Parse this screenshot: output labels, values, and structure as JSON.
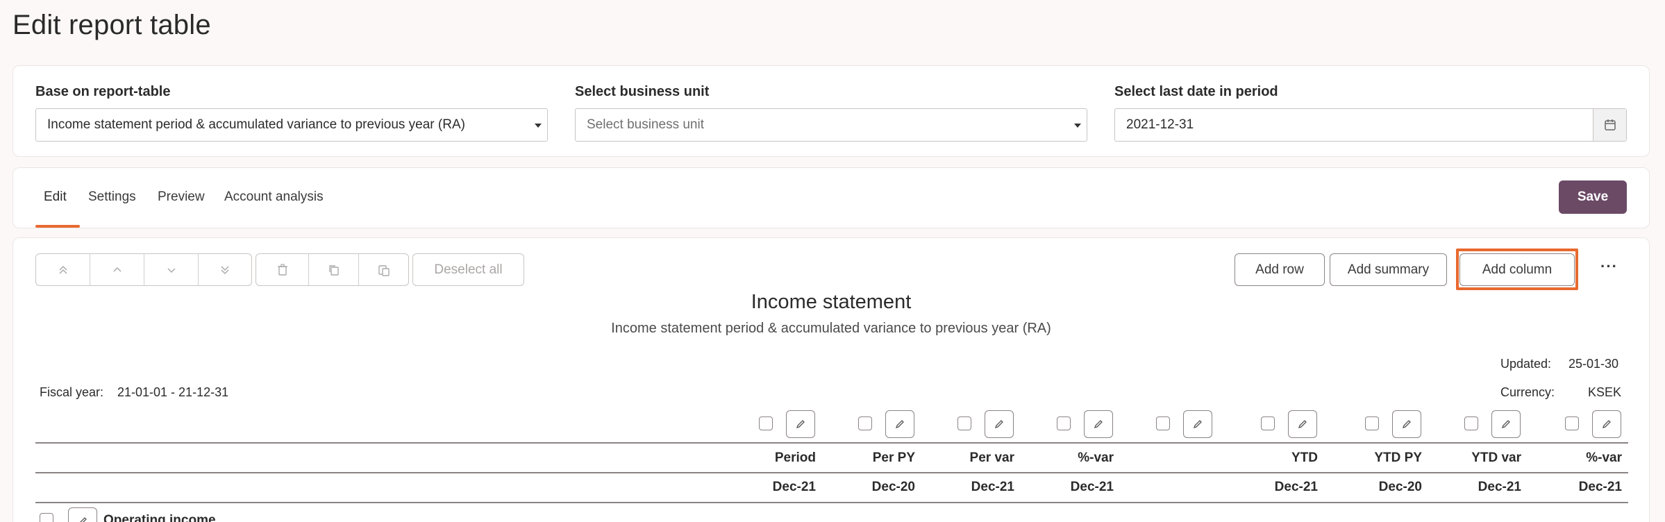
{
  "page": {
    "title": "Edit report table"
  },
  "filters": {
    "base": {
      "label": "Base on report-table",
      "value": "Income statement period & accumulated variance to previous year (RA)"
    },
    "business_unit": {
      "label": "Select business unit",
      "placeholder": "Select business unit"
    },
    "date": {
      "label": "Select last date in period",
      "value": "2021-12-31"
    }
  },
  "tabs": [
    "Edit",
    "Settings",
    "Preview",
    "Account analysis"
  ],
  "active_tab": "Edit",
  "save_label": "Save",
  "toolbar": {
    "deselect_label": "Deselect all",
    "add_row": "Add row",
    "add_summary": "Add summary",
    "add_column": "Add column",
    "more": "···"
  },
  "report": {
    "title": "Income statement",
    "subtitle": "Income statement period & accumulated variance to previous year (RA)",
    "updated_label": "Updated:",
    "updated_value": "25-01-30",
    "fiscal_label": "Fiscal year:",
    "fiscal_value": "21-01-01 - 21-12-31",
    "currency_label": "Currency:",
    "currency_value": "KSEK"
  },
  "columns": [
    {
      "name": "Period",
      "date": "Dec-21"
    },
    {
      "name": "Per PY",
      "date": "Dec-20"
    },
    {
      "name": "Per var",
      "date": "Dec-21"
    },
    {
      "name": "%-var",
      "date": "Dec-21"
    },
    {
      "name": "",
      "date": ""
    },
    {
      "name": "YTD",
      "date": "Dec-21"
    },
    {
      "name": "YTD PY",
      "date": "Dec-20"
    },
    {
      "name": "YTD var",
      "date": "Dec-21"
    },
    {
      "name": "%-var",
      "date": "Dec-21"
    }
  ],
  "rows": [
    {
      "label": "Operating income"
    }
  ],
  "colors": {
    "accent": "#e8692f",
    "primary": "#6b4a66"
  }
}
